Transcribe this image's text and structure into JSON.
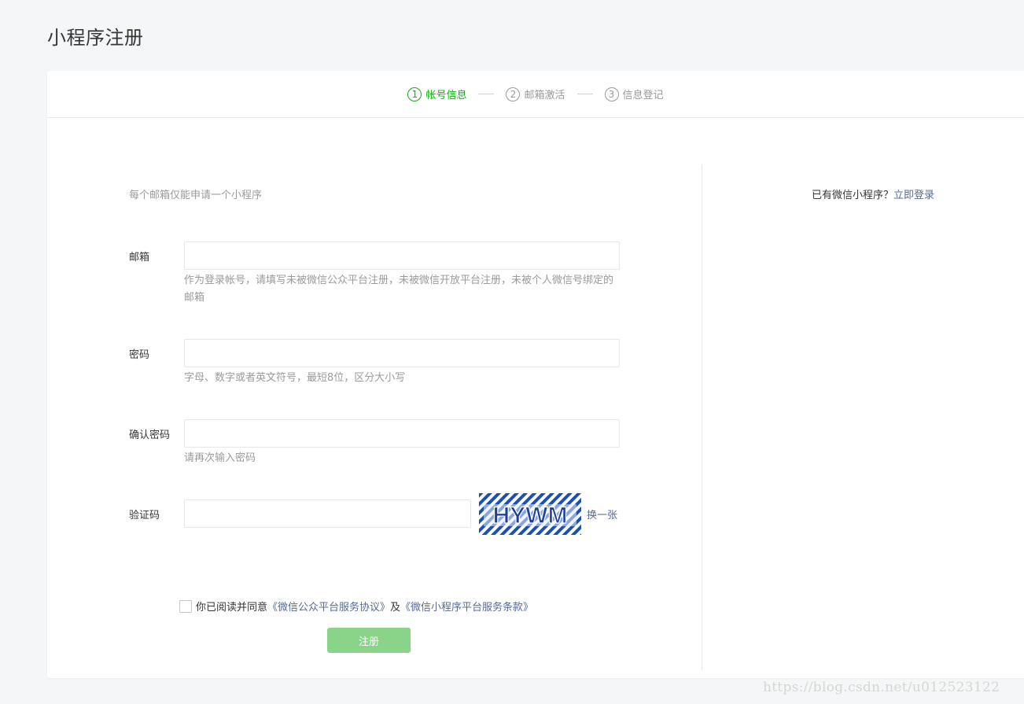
{
  "page": {
    "title": "小程序注册"
  },
  "steps": [
    {
      "num": "1",
      "label": "帐号信息",
      "active": true
    },
    {
      "num": "2",
      "label": "邮箱激活",
      "active": false
    },
    {
      "num": "3",
      "label": "信息登记",
      "active": false
    }
  ],
  "form": {
    "tip": "每个邮箱仅能申请一个小程序",
    "email": {
      "label": "邮箱",
      "value": "",
      "desc": "作为登录帐号，请填写未被微信公众平台注册，未被微信开放平台注册，未被个人微信号绑定的邮箱"
    },
    "password": {
      "label": "密码",
      "value": "",
      "desc": "字母、数字或者英文符号，最短8位，区分大小写"
    },
    "confirm": {
      "label": "确认密码",
      "value": "",
      "desc": "请再次输入密码"
    },
    "captcha": {
      "label": "验证码",
      "value": "",
      "image_text": "HYWM",
      "refresh_label": "换一张"
    },
    "agreement": {
      "prefix": "你已阅读并同意",
      "link1": "《微信公众平台服务协议》",
      "middle": "及",
      "link2": "《微信小程序平台服务条款》",
      "checked": false
    },
    "submit_label": "注册"
  },
  "side": {
    "prompt": "已有微信小程序？",
    "login_link": "立即登录"
  },
  "watermark": "https://blog.csdn.net/u012523122",
  "colors": {
    "accent_green": "#1aad19",
    "link_blue": "#576b95",
    "button_disabled": "#8ad48a"
  }
}
